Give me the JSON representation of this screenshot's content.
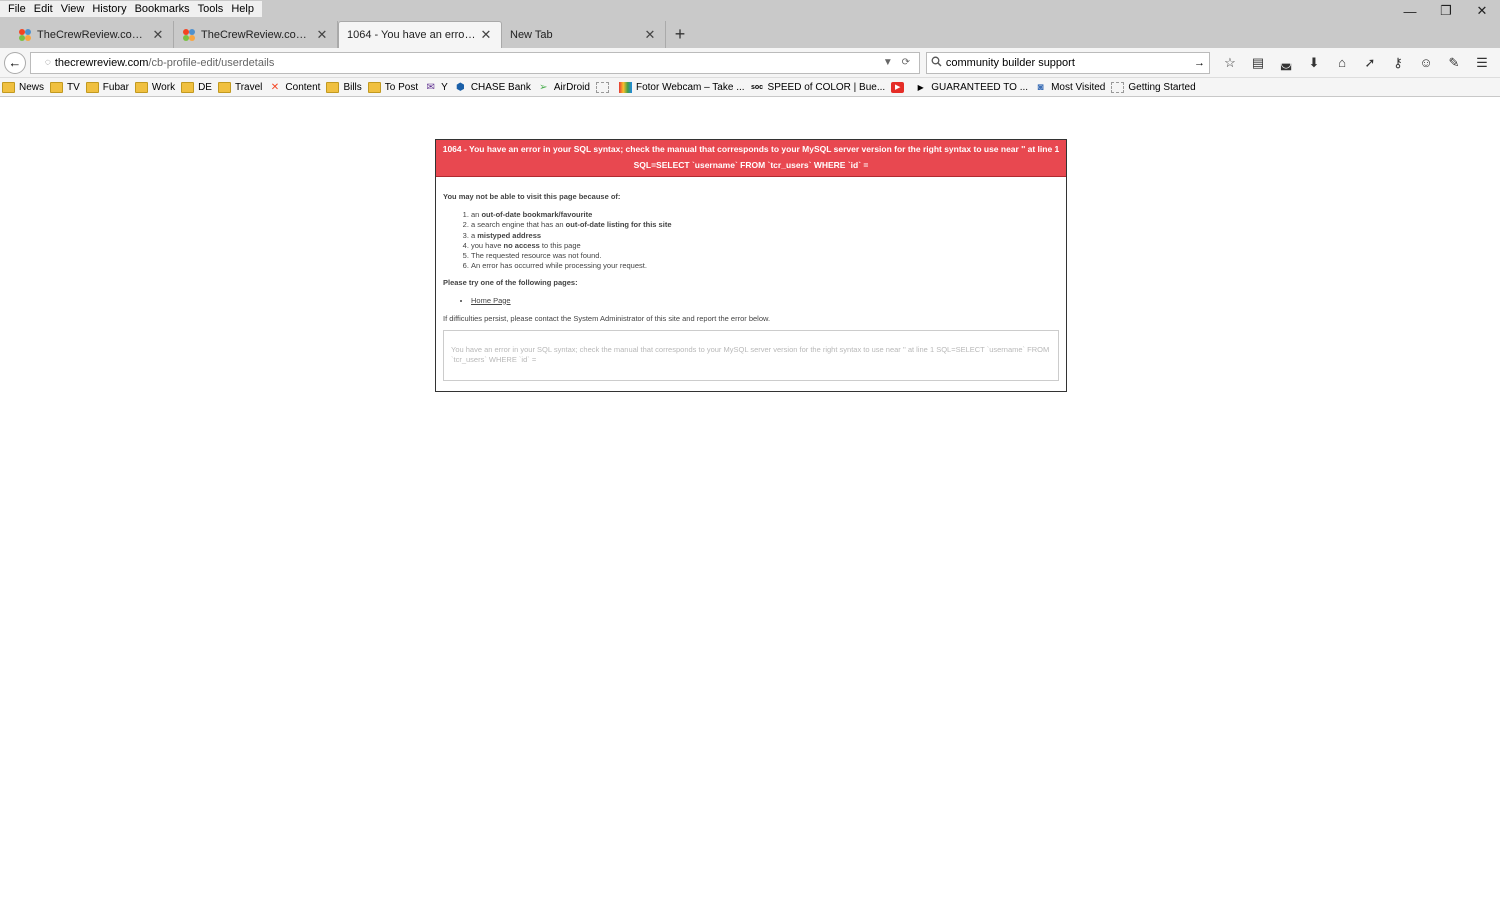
{
  "menu": [
    "File",
    "Edit",
    "View",
    "History",
    "Bookmarks",
    "Tools",
    "Help"
  ],
  "window_controls": {
    "minimize": "—",
    "restore": "❐",
    "close": "✕"
  },
  "tabs": [
    {
      "title": "TheCrewReview.com - Ad...",
      "active": false
    },
    {
      "title": "TheCrewReview.com - Ad...",
      "active": false
    },
    {
      "title": "1064 - You have an error in yo...",
      "active": true
    },
    {
      "title": "New Tab",
      "active": false
    }
  ],
  "newtab": "+",
  "nav": {
    "url_domain": "thecrewreview.com",
    "url_path": "/cb-profile-edit/userdetails",
    "search_value": "community builder support"
  },
  "bookmarks": [
    {
      "label": "News",
      "icon": "folder"
    },
    {
      "label": "TV",
      "icon": "folder"
    },
    {
      "label": "Fubar",
      "icon": "folder"
    },
    {
      "label": "Work",
      "icon": "folder"
    },
    {
      "label": "DE",
      "icon": "folder"
    },
    {
      "label": "Travel",
      "icon": "folder"
    },
    {
      "label": "Content",
      "icon": "joomla"
    },
    {
      "label": "Bills",
      "icon": "folder"
    },
    {
      "label": "To Post",
      "icon": "folder"
    },
    {
      "label": "Y",
      "icon": "mail"
    },
    {
      "label": "CHASE Bank",
      "icon": "chase"
    },
    {
      "label": "AirDroid",
      "icon": "airdroid"
    },
    {
      "label": "",
      "icon": "blank"
    },
    {
      "label": "Fotor Webcam – Take ...",
      "icon": "fotor"
    },
    {
      "label": "SPEED of COLOR | Bue...",
      "icon": "soc"
    },
    {
      "label": "",
      "icon": "youtube"
    },
    {
      "label": "GUARANTEED TO ...",
      "icon": "play"
    },
    {
      "label": "Most Visited",
      "icon": "mostvisited"
    },
    {
      "label": "Getting Started",
      "icon": "blank"
    }
  ],
  "error": {
    "header": "1064 - You have an error in your SQL syntax; check the manual that corresponds to your MySQL server version for the right syntax to use near '' at line 1 SQL=SELECT `username` FROM `tcr_users` WHERE `id` =",
    "intro": "You may not be able to visit this page because of:",
    "reasons": [
      {
        "pre": "an ",
        "bold": "out-of-date bookmark/favourite",
        "post": ""
      },
      {
        "pre": "a search engine that has an ",
        "bold": "out-of-date listing for this site",
        "post": ""
      },
      {
        "pre": "a ",
        "bold": "mistyped address",
        "post": ""
      },
      {
        "pre": "you have ",
        "bold": "no access",
        "post": " to this page"
      },
      {
        "pre": "The requested resource was not found.",
        "bold": "",
        "post": ""
      },
      {
        "pre": "An error has occurred while processing your request.",
        "bold": "",
        "post": ""
      }
    ],
    "try": "Please try one of the following pages:",
    "pages": [
      "Home Page"
    ],
    "persist": "If difficulties persist, please contact the System Administrator of this site and report the error below.",
    "detail": "You have an error in your SQL syntax; check the manual that corresponds to your MySQL server version for the right syntax to use near '' at line 1 SQL=SELECT `username` FROM `tcr_users` WHERE `id` ="
  },
  "colors": {
    "error_header": "#e84850"
  }
}
